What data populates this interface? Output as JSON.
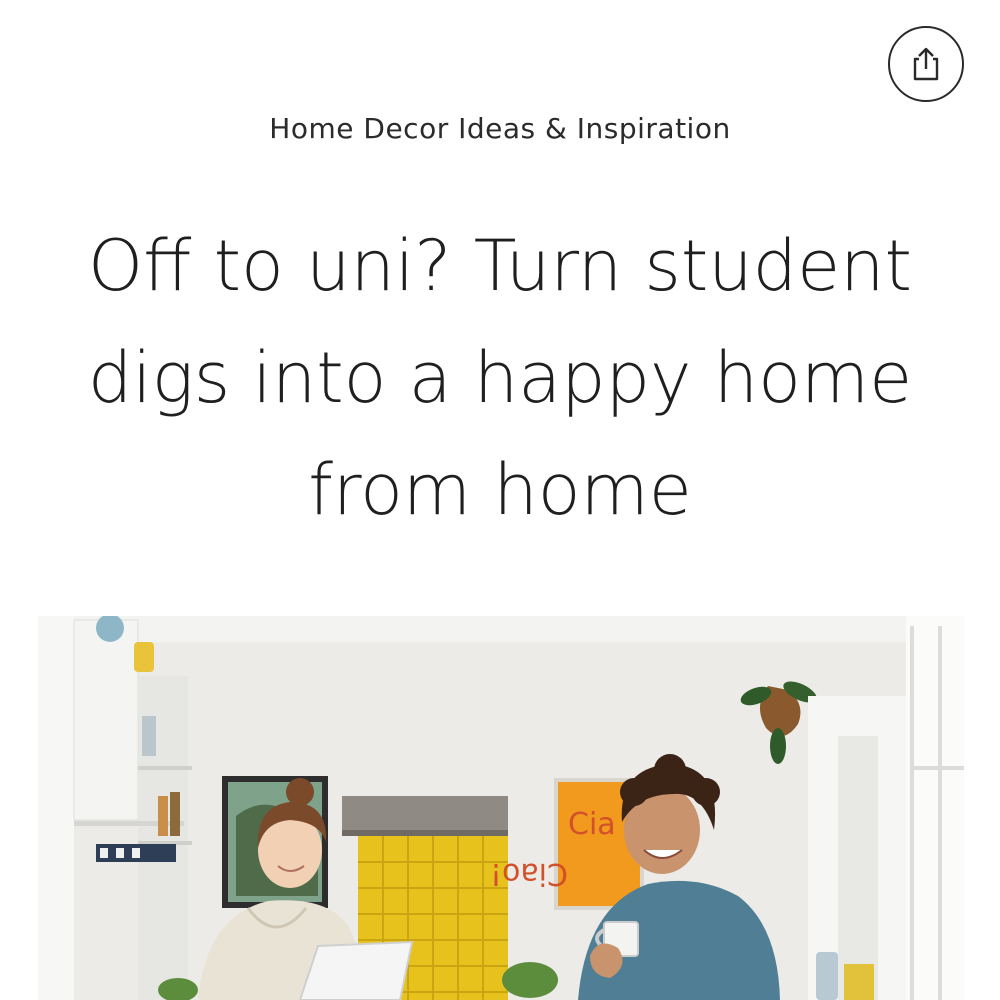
{
  "header": {
    "share_icon": "share-icon"
  },
  "article": {
    "category": "Home Decor Ideas & Inspiration",
    "title": "Off to uni? Turn student digs into a happy home from home"
  },
  "hero_image": {
    "poster_text_top": "Cia",
    "poster_text_bottom": "Ciao!",
    "colors": {
      "wall": "#ecebe8",
      "tile_yellow": "#e8c21c",
      "poster_orange": "#f29a1e",
      "sweater_blue": "#4f7e95",
      "hoodie_beige": "#e9e3d6"
    }
  }
}
